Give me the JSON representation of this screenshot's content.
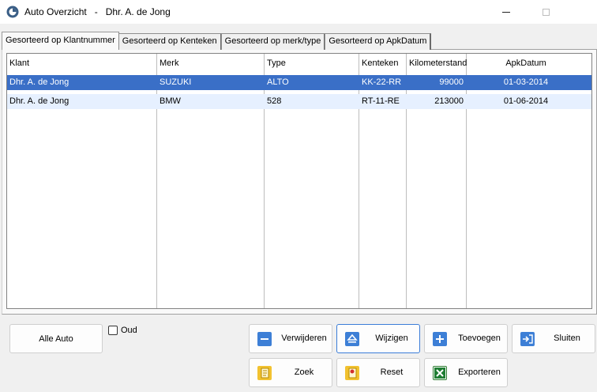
{
  "window": {
    "title": "Auto Overzicht   -   Dhr. A. de Jong"
  },
  "tabs": [
    {
      "label": "Gesorteerd op Klantnummer",
      "active": true
    },
    {
      "label": "Gesorteerd op Kenteken"
    },
    {
      "label": "Gesorteerd op merk/type"
    },
    {
      "label": "Gesorteerd op ApkDatum"
    }
  ],
  "list": {
    "columns": [
      "Klant",
      "Merk",
      "Type",
      "Kenteken",
      "Kilometerstand",
      "ApkDatum"
    ],
    "rows": [
      [
        "Dhr. A. de Jong",
        "SUZUKI",
        "ALTO",
        "KK-22-RR",
        "99000",
        "01-03-2014"
      ],
      [
        "Dhr. A. de Jong",
        "BMW",
        "528",
        "RT-11-RE",
        "213000",
        "01-06-2014"
      ]
    ]
  },
  "buttons": {
    "alle_auto": "Alle Auto",
    "verwijderen": "Verwijderen",
    "wijzigen": "Wijzigen",
    "toevoegen": "Toevoegen",
    "sluiten": "Sluiten",
    "zoek": "Zoek",
    "reset": "Reset",
    "exporteren": "Exporteren"
  },
  "oud_checkbox": {
    "label": "Oud",
    "checked": false
  }
}
